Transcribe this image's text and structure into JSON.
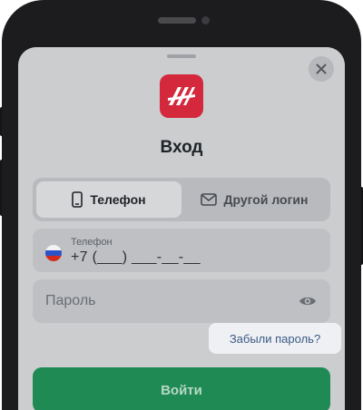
{
  "screen": {
    "title": "Вход",
    "tabs": [
      {
        "label": "Телефон",
        "icon": "smartphone-icon",
        "active": true
      },
      {
        "label": "Другой логин",
        "icon": "envelope-icon",
        "active": false
      }
    ],
    "phone_field": {
      "label": "Телефон",
      "value": "+7 (___) ___-__-__",
      "flag": "russia-flag-icon"
    },
    "password_field": {
      "placeholder": "Пароль",
      "icon": "eye-icon"
    },
    "forgot_password": "Забыли пароль?",
    "submit_label": "Войти",
    "logo_icon": "brand-logo-icon",
    "close_icon": "close-icon"
  },
  "colors": {
    "brand": "#d4283c",
    "primary_button": "#1f8a53",
    "link": "#3c5a86",
    "overlay": "#cbcdce"
  }
}
